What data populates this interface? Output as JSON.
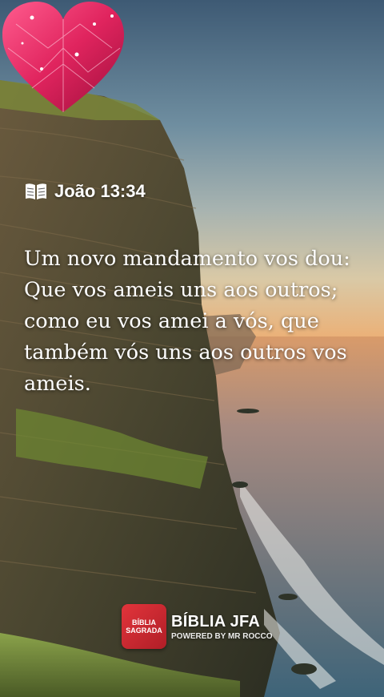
{
  "verse": {
    "reference": "João 13:34",
    "text": "Um novo mandamento vos dou: Que vos ameis uns aos outros; como eu vos amei a vós, que também vós uns aos outros vos ameis."
  },
  "logo": {
    "badge_text": "BÍBLIA SAGRADA",
    "name": "BÍBLIA JFA",
    "subtitle": "POWERED BY MR ROCCO"
  },
  "icons": {
    "reference": "open-book-icon",
    "decoration": "heart-gem-icon"
  },
  "colors": {
    "text": "#ffffff",
    "heart": "#e0245e",
    "logo_badge": "#d3252e"
  }
}
